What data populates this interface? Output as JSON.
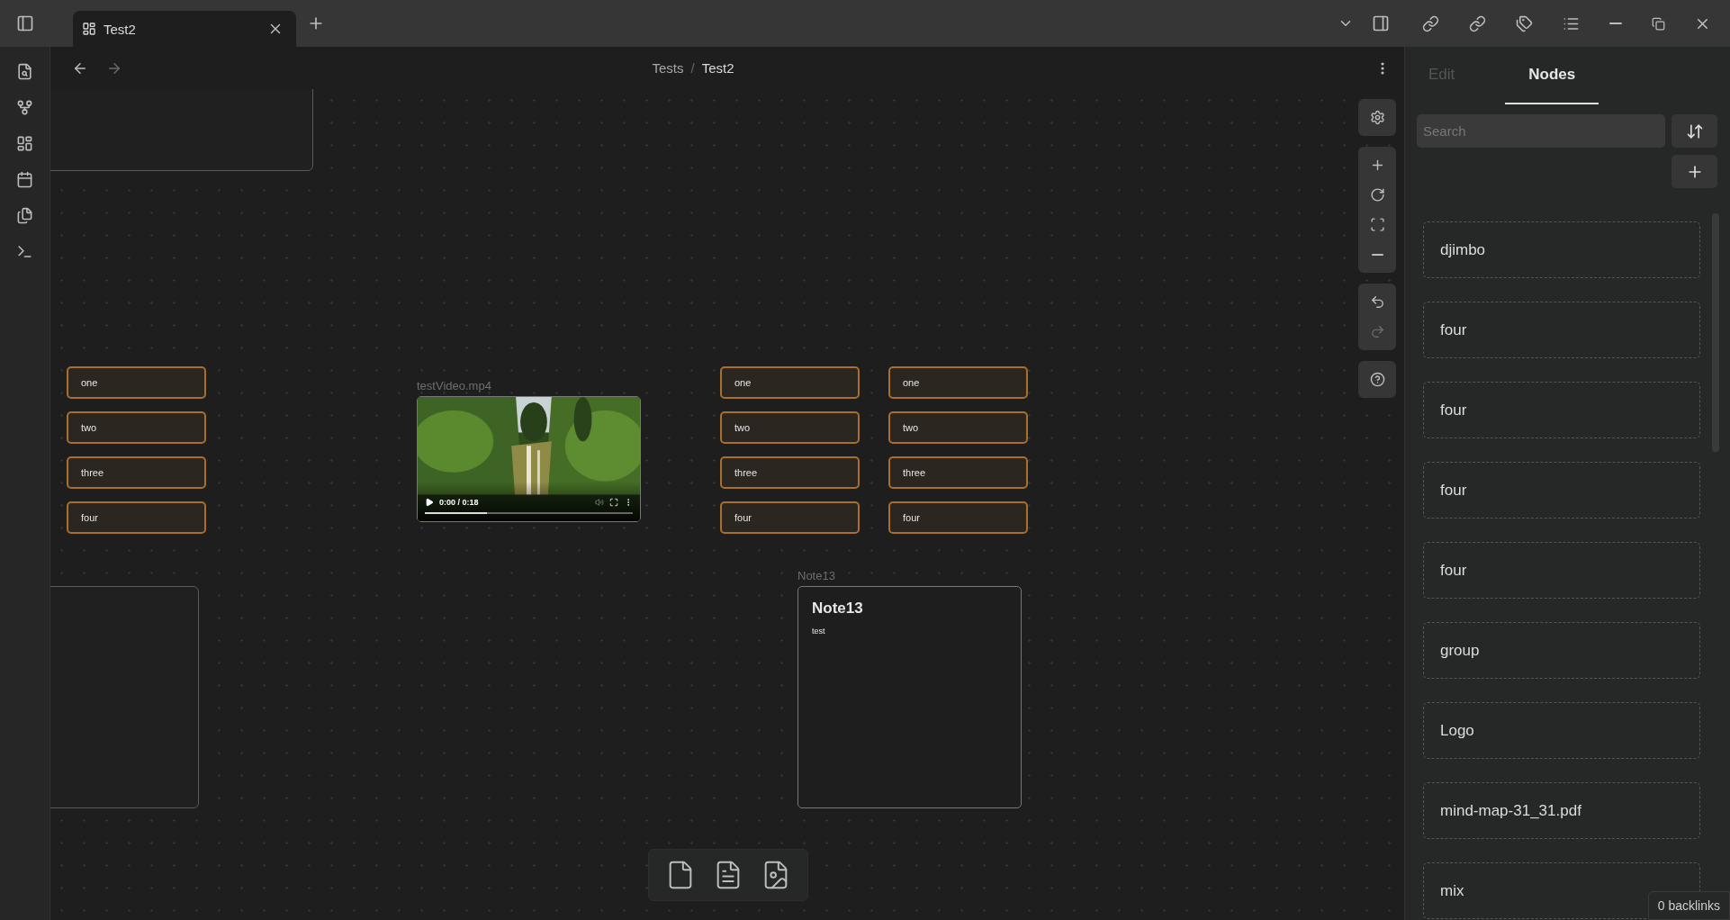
{
  "title_bar": {
    "tabs": [
      {
        "title": "Test2",
        "selected": true
      }
    ]
  },
  "nav": {
    "breadcrumb": {
      "items": [
        "Tests",
        "Test2"
      ],
      "separator": "/"
    }
  },
  "canvas": {
    "nodes": [
      {
        "kind": "card"
      },
      {
        "kind": "stack",
        "items": [
          "one",
          "two",
          "three",
          "four"
        ]
      },
      {
        "kind": "video",
        "label": "testVideo.mp4",
        "time": "0:00 / 0:18",
        "level": 0.3
      },
      {
        "kind": "stack",
        "items": [
          "one",
          "two",
          "three",
          "four"
        ]
      },
      {
        "kind": "stack",
        "items": [
          "one",
          "two",
          "three",
          "four"
        ]
      },
      {
        "kind": "card"
      },
      {
        "kind": "note",
        "label": "Note13",
        "heading": "Note13",
        "body": "test"
      }
    ]
  },
  "sidebar": {
    "tabs": [
      {
        "label": "Edit",
        "selected": false
      },
      {
        "label": "Nodes",
        "selected": true
      }
    ],
    "search": {
      "placeholder": "Search"
    },
    "items": [
      "djimbo",
      "four",
      "four",
      "four",
      "four",
      "group",
      "Logo",
      "mind-map-31_31.pdf",
      "mix"
    ],
    "backlinks": "0 backlinks"
  }
}
